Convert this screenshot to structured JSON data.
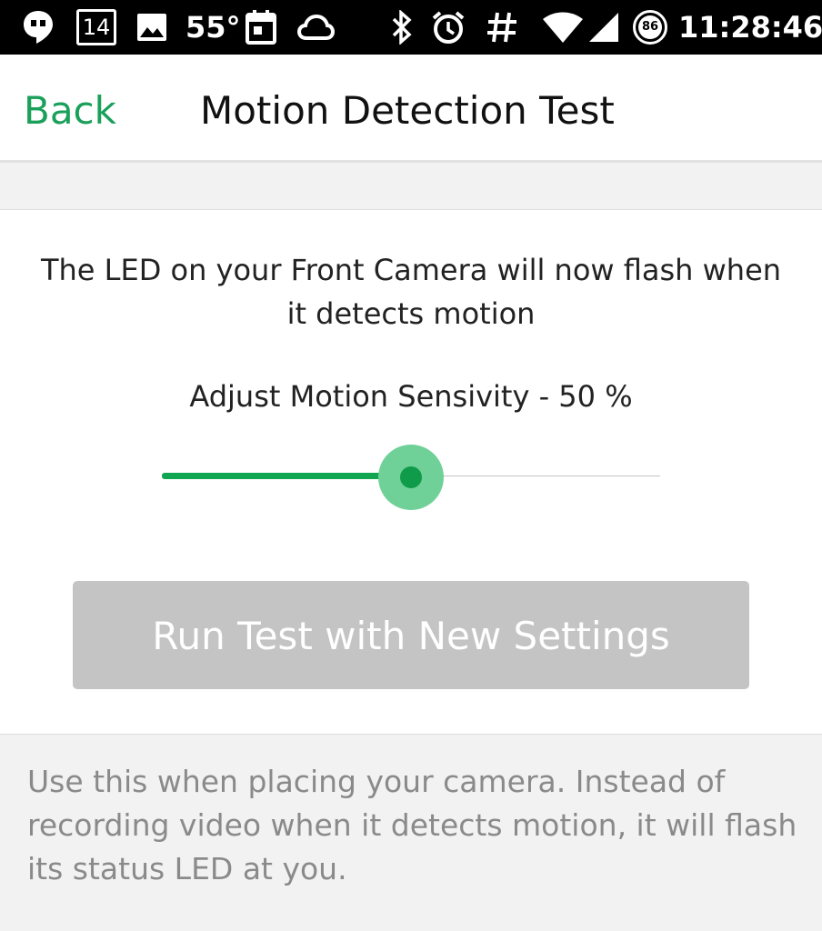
{
  "status_bar": {
    "notification_count": "14",
    "temperature": "55°",
    "battery_level": "86",
    "time": "11:28:46",
    "icons": [
      "hangouts-icon",
      "calendar-notification-icon",
      "image-icon",
      "calendar-icon",
      "cloud-icon",
      "bluetooth-icon",
      "alarm-icon",
      "hash-icon",
      "wifi-icon",
      "cell-signal-icon",
      "battery-icon"
    ]
  },
  "header": {
    "back_label": "Back",
    "title": "Motion Detection Test"
  },
  "main": {
    "info_text": "The LED on your Front Camera will now flash when it detects motion",
    "sensitivity_label": "Adjust Motion Sensivity - 50 %",
    "sensitivity_value": 50,
    "run_button_label": "Run Test with New Settings",
    "description": "Use this when placing your camera.  Instead of recording video when it detects motion, it will flash its status LED at you."
  },
  "colors": {
    "accent": "#1aa05a",
    "slider_fill": "#10a651",
    "slider_halo": "#6fd197",
    "button_disabled": "#c4c4c4"
  }
}
